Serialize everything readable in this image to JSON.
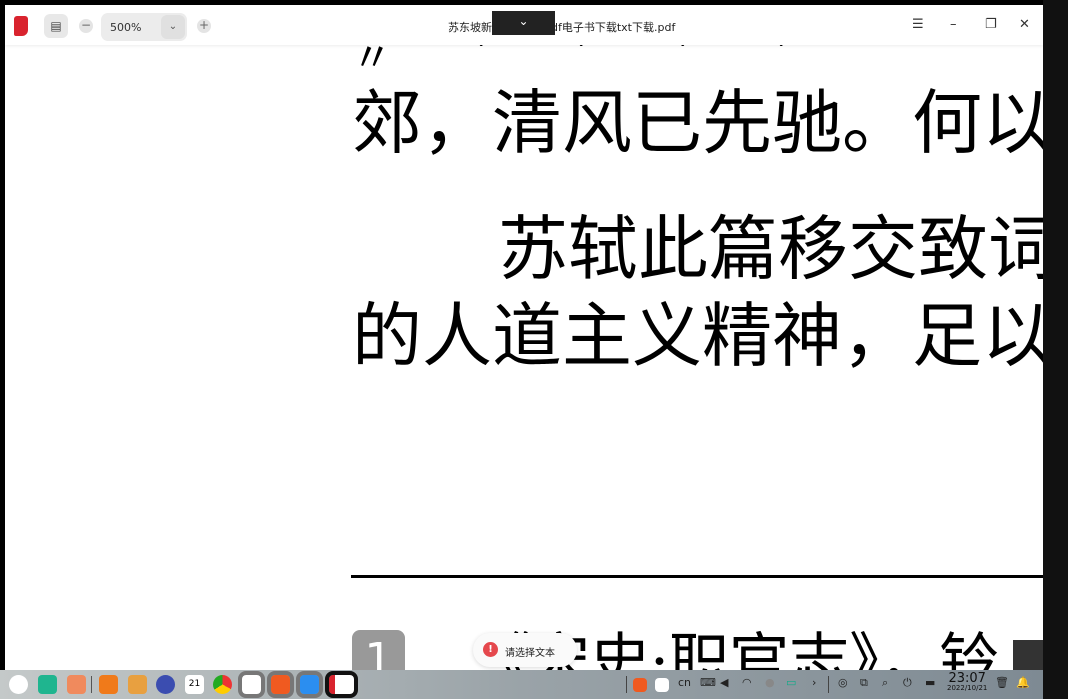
{
  "toolbar": {
    "zoom_value": "500%",
    "title_left": "苏东坡新作",
    "title_right": "df电子书下载txt下载.pdf"
  },
  "page": {
    "lines": [
      "郊，清风已先驰。何以",
      "苏轼此篇移交致词",
      "的人道主义精神，足以"
    ],
    "footnote_number": "1",
    "footnote_text": "《宋史·职官志》，铃"
  },
  "toast": {
    "message": "请选择文本"
  },
  "tray": {
    "input_method": "cn",
    "time": "23:07",
    "date": "2022/10/21"
  }
}
